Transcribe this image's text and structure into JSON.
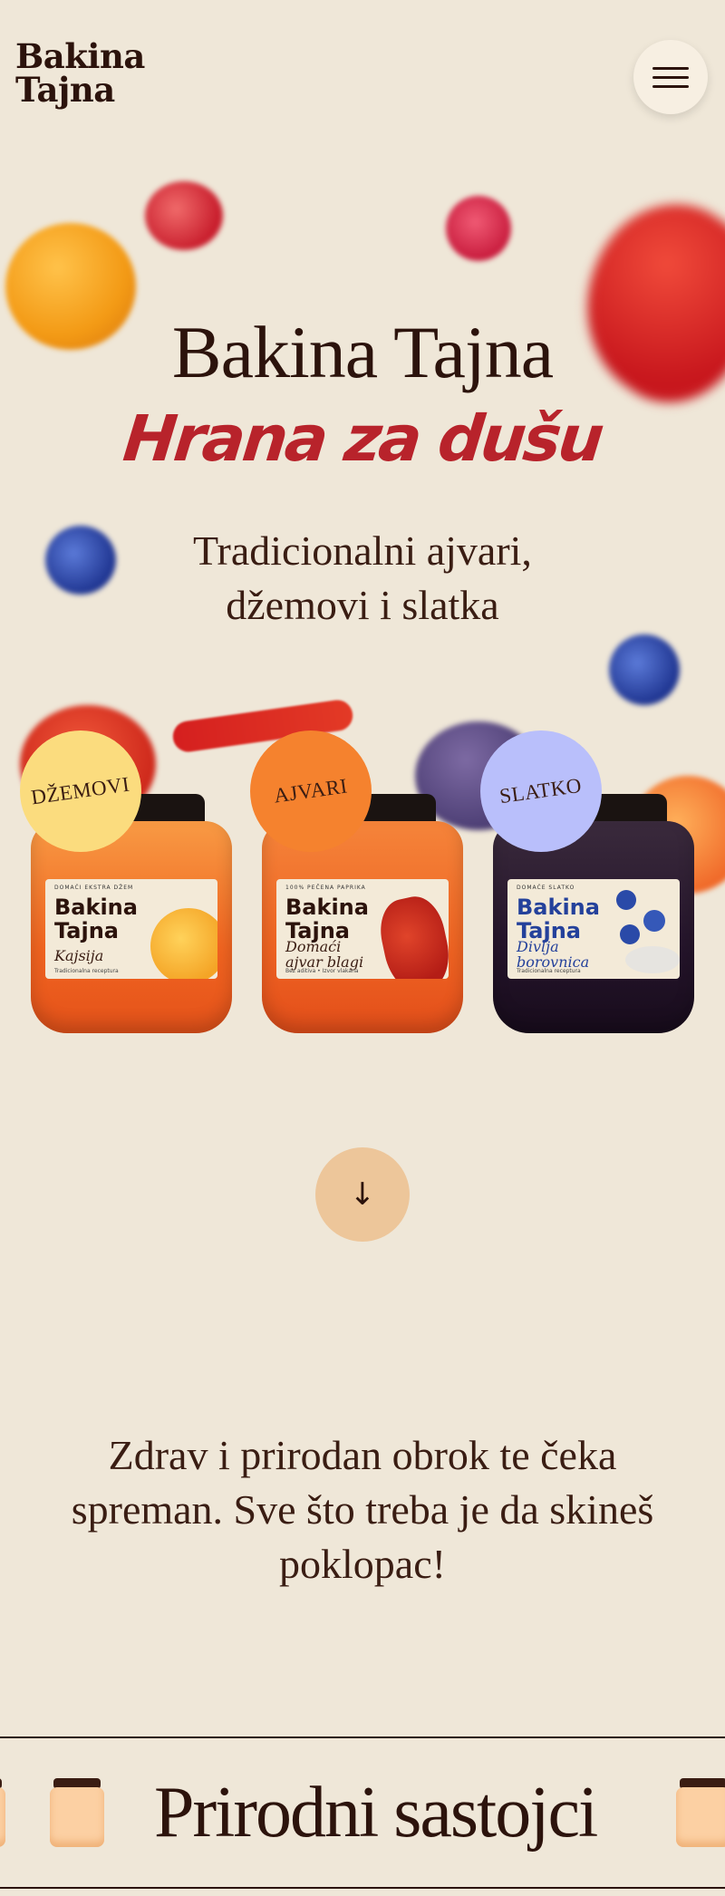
{
  "header": {
    "logo_line1": "Bakina",
    "logo_line2": "Tajna",
    "menu_icon": "hamburger-menu-icon"
  },
  "hero": {
    "title": "Bakina Tajna",
    "script_line": "Hrana za dušu",
    "subtitle_line1": "Tradicionalni ajvari,",
    "subtitle_line2": "džemovi i slatka"
  },
  "products": [
    {
      "badge": "DŽEMOVI",
      "badge_color": "#fbdc7e",
      "jar_color": "#f47a2a",
      "label_top": "DOMAĆI EKSTRA DŽEM",
      "brand_line1": "Bakina",
      "brand_line2": "Tajna",
      "flavor_line1": "Kajsija",
      "flavor_line2": "",
      "label_foot": "Tradicionalna receptura"
    },
    {
      "badge": "AJVARI",
      "badge_color": "#f5822e",
      "jar_color": "#ee6a25",
      "label_top": "100% PEČENA PAPRIKA",
      "brand_line1": "Bakina",
      "brand_line2": "Tajna",
      "flavor_line1": "Domaći",
      "flavor_line2": "ajvar blagi",
      "label_foot": "Bez aditiva • Izvor vlakana"
    },
    {
      "badge": "SLATKO",
      "badge_color": "#b9bffb",
      "jar_color": "#2d1a2d",
      "label_top": "DOMAĆE SLATKO",
      "brand_line1": "Bakina",
      "brand_line2": "Tajna",
      "flavor_line1": "Divlja",
      "flavor_line2": "borovnica",
      "label_foot": "Tradicionalna receptura"
    }
  ],
  "scroll_icon": "arrow-down-icon",
  "scroll_glyph": "↓",
  "blurb": {
    "line1": "Zdrav i prirodan obrok te čeka",
    "line2": "spreman. Sve što treba je da skineš",
    "line3": "poklopac!"
  },
  "marquee": {
    "text": "Prirodni sastojci"
  },
  "colors": {
    "background": "#efe7d8",
    "accent_red": "#b8232b",
    "text_dark": "#2c130c"
  }
}
